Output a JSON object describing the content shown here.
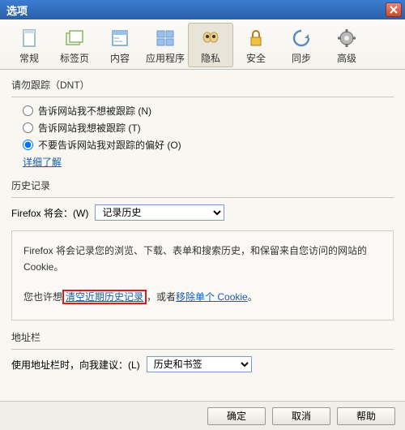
{
  "titlebar": {
    "title": "选项"
  },
  "toolbar": {
    "items": [
      {
        "label": "常规"
      },
      {
        "label": "标签页"
      },
      {
        "label": "内容"
      },
      {
        "label": "应用程序"
      },
      {
        "label": "隐私"
      },
      {
        "label": "安全"
      },
      {
        "label": "同步"
      },
      {
        "label": "高级"
      }
    ]
  },
  "dnt": {
    "title": "请勿跟踪（DNT）",
    "opt1": "告诉网站我不想被跟踪 (N)",
    "opt2": "告诉网站我想被跟踪 (T)",
    "opt3": "不要告诉网站我对跟踪的偏好 (O)",
    "more": "详细了解"
  },
  "history": {
    "title": "历史记录",
    "label": "Firefox 将会：(W)",
    "select_value": "记录历史",
    "desc1": "Firefox 将会记录您的浏览、下载、表单和搜索历史，和保留来自您访问的网站的 Cookie。",
    "desc2_prefix": "您也许想",
    "clear_link": "清空近期历史记录",
    "desc2_mid": "，或者",
    "remove_link": "移除单个 Cookie",
    "desc2_suffix": "。"
  },
  "addrbar": {
    "title": "地址栏",
    "label": "使用地址栏时，向我建议：(L)",
    "select_value": "历史和书签"
  },
  "buttons": {
    "ok": "确定",
    "cancel": "取消",
    "help": "帮助"
  }
}
